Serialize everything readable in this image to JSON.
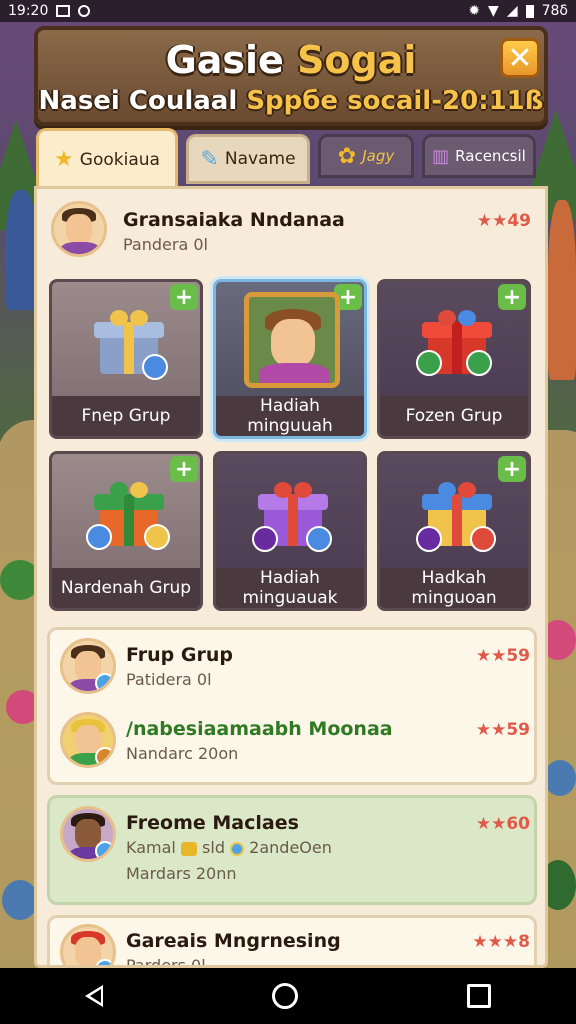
{
  "status_bar": {
    "time": "19:20",
    "battery": "78δ"
  },
  "header": {
    "title_part1": "Gasie ",
    "title_part2": "Sogai",
    "subtitle_part1": "Nasei Coulaal ",
    "subtitle_part2": "Sppбe socail-20:11ß"
  },
  "tabs": [
    {
      "label": "Gookiaua",
      "icon": "star-icon",
      "state": "active"
    },
    {
      "label": "Navame",
      "icon": "pencil-icon",
      "state": "light"
    },
    {
      "label": "Jagy",
      "icon": "gear-icon",
      "state": "dark"
    },
    {
      "label": "Racencsil",
      "icon": "trash-icon",
      "state": "dark"
    }
  ],
  "profile": {
    "name": "Gransaiaka Nndanaa",
    "sub": "Pandera 0l",
    "score": "49"
  },
  "gifts": [
    {
      "label": "Fnep Grup",
      "style": "gift-blue-gold"
    },
    {
      "label": "Hadiah minguuah",
      "style": "portrait"
    },
    {
      "label": "Fozen Grup",
      "style": "gift-red"
    },
    {
      "label": "Nardenah Grup",
      "style": "gift-orange-green"
    },
    {
      "label": "Hadiah minguauak",
      "style": "gift-purple"
    },
    {
      "label": "Hadkah minguoan",
      "style": "gift-yellow-blue"
    }
  ],
  "list": [
    {
      "name": "Frup Grup",
      "sub": "Patidera 0l",
      "score": "59"
    },
    {
      "name": "/nabesiaamaabh Moonaa",
      "sub": "Nandarc 20on",
      "score": "59"
    },
    {
      "name": "Freome Maclaes",
      "sub_prefix": "Kamal",
      "sub_mid": "sld",
      "sub_suffix": "2andeOen",
      "sub2": "Mardars 20nn",
      "score": "60"
    },
    {
      "name": "Gareais Mngrnesing",
      "sub": "Parders 0l",
      "score": "8"
    }
  ],
  "colors": {
    "accent": "#f7c24a",
    "score": "#e05a4a",
    "plus": "#6bbd4a",
    "highlight_row": "#dbe8c8"
  }
}
